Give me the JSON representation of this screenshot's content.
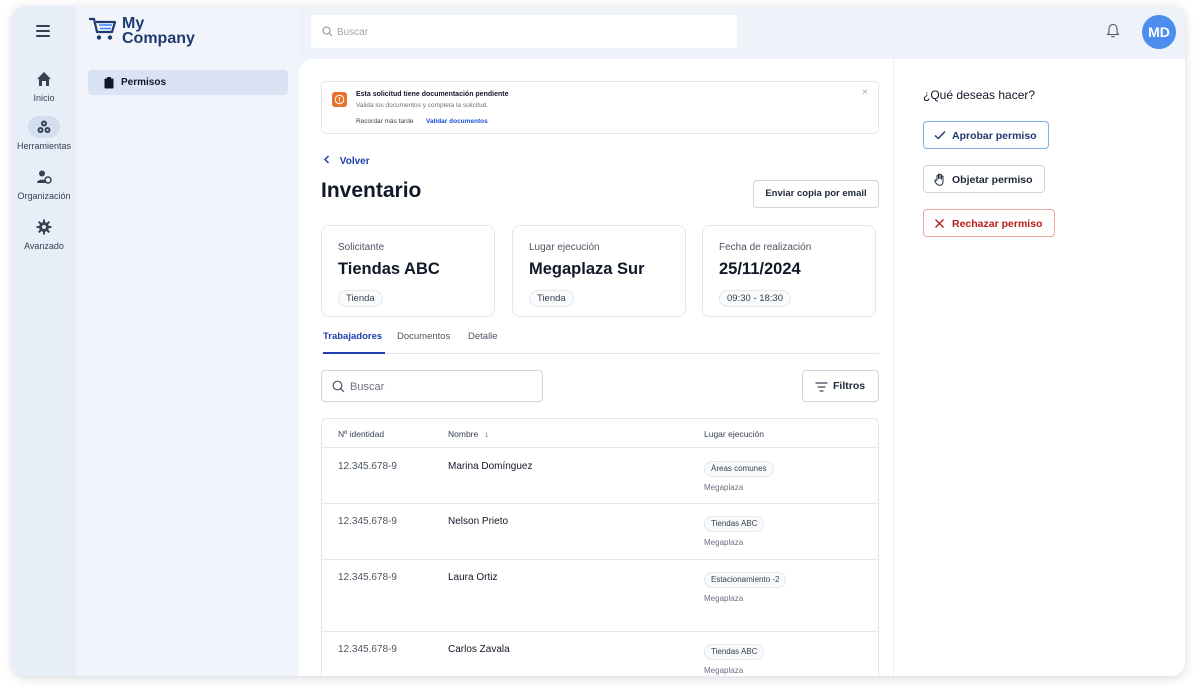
{
  "app": {
    "name_line1": "My",
    "name_line2": "Company"
  },
  "topbar": {
    "search_placeholder": "Buscar",
    "avatar_initials": "MD"
  },
  "rail": {
    "items": [
      {
        "label": "Inicio",
        "icon": "home-icon"
      },
      {
        "label": "Herramientas",
        "icon": "tools-icon"
      },
      {
        "label": "Organización",
        "icon": "users-icon"
      },
      {
        "label": "Avanzado",
        "icon": "gear-icon"
      }
    ]
  },
  "sidebar": {
    "items": [
      {
        "label": "Permisos",
        "icon": "clipboard-icon"
      }
    ]
  },
  "alert": {
    "title": "Esta solicitud tiene documentación pendiente",
    "message": "Valida los documentos y completa la solicitud.",
    "later_label": "Recordar más tarde",
    "validate_label": "Validar documentos",
    "close_glyph": "×",
    "color": "#e8722c"
  },
  "page": {
    "back_label": "Volver",
    "title": "Inventario",
    "email_button": "Enviar copia por email"
  },
  "cards": [
    {
      "label": "Solicitante",
      "value": "Tiendas ABC",
      "chip": "Tienda"
    },
    {
      "label": "Lugar ejecución",
      "value": "Megaplaza Sur",
      "chip": "Tienda"
    },
    {
      "label": "Fecha de realización",
      "value": "25/11/2024",
      "chip": "09:30 - 18:30"
    }
  ],
  "tabs": [
    {
      "label": "Trabajadores",
      "active": true
    },
    {
      "label": "Documentos",
      "active": false
    },
    {
      "label": "Detalle",
      "active": false
    }
  ],
  "list": {
    "search_placeholder": "Buscar",
    "filter_label": "Filtros"
  },
  "table": {
    "headers": [
      "Nº identidad",
      "Nombre",
      "Lugar ejecución"
    ],
    "sort_glyph": "↓",
    "rows": [
      {
        "id": "12.345.678-9",
        "name": "Marina Domínguez",
        "place": "Áreas comunes",
        "sub": "Megaplaza"
      },
      {
        "id": "12.345.678-9",
        "name": "Nelson Prieto",
        "place": "Tiendas ABC",
        "sub": "Megaplaza"
      },
      {
        "id": "12.345.678-9",
        "name": "Laura Ortiz",
        "place": "Estacionamiento -2",
        "sub": "Megaplaza"
      },
      {
        "id": "12.345.678-9",
        "name": "Carlos Zavala",
        "place": "Tiendas ABC",
        "sub": "Megaplaza"
      }
    ]
  },
  "actions": {
    "title": "¿Qué deseas hacer?",
    "approve": "Aprobar permiso",
    "object": "Objetar permiso",
    "reject": "Rechazar permiso"
  },
  "colors": {
    "primary": "#1e40af",
    "avatar": "#4b8ef0",
    "reject": "#b91c1c",
    "warning": "#e8722c"
  }
}
